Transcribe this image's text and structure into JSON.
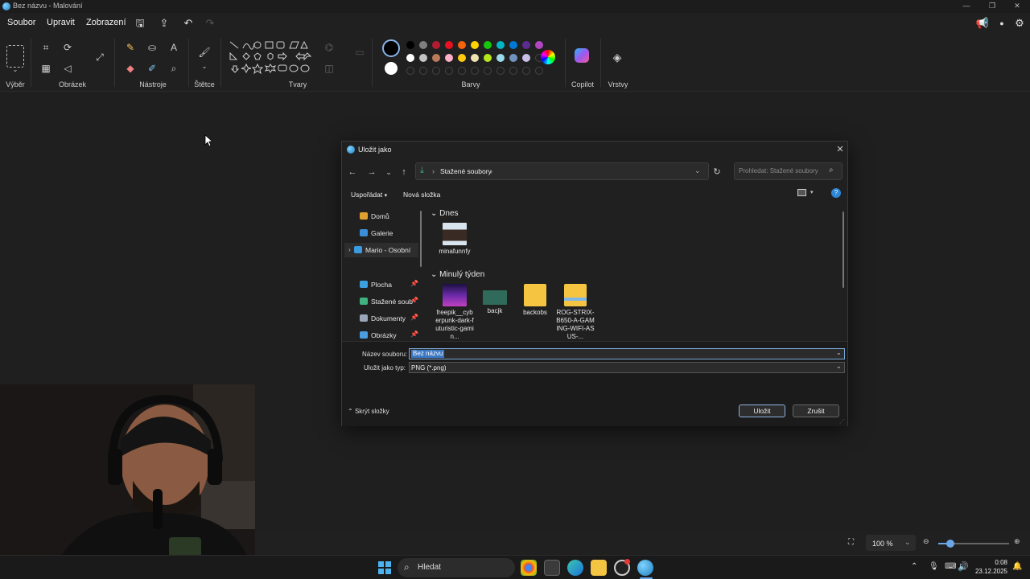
{
  "window": {
    "title": "Bez názvu - Malování"
  },
  "menu": {
    "items": [
      "Soubor",
      "Upravit",
      "Zobrazení"
    ]
  },
  "ribbon": {
    "groups": [
      "Výběr",
      "Obrázek",
      "Nástroje",
      "Štětce",
      "Tvary",
      "Barvy",
      "Copilot",
      "Vrstvy"
    ],
    "colors": [
      "#000000",
      "#7f7f7f",
      "#b21b32",
      "#e81123",
      "#f7630c",
      "#ffd400",
      "#16c60c",
      "#00b7c3",
      "#0078d4",
      "#5c2d91",
      "#b146c2",
      "#ffffff",
      "#c3c3c3",
      "#b97a57",
      "#ffaec9",
      "#ffc90e",
      "#efe4b0",
      "#b5e61d",
      "#99d9ea",
      "#7092be",
      "#c8bfe7"
    ]
  },
  "dialog": {
    "title": "Uložit jako",
    "breadcrumb": "Stažené soubory",
    "search_placeholder": "Prohledat: Stažené soubory",
    "organize": "Uspořádat",
    "new_folder": "Nová složka",
    "nav": [
      {
        "label": "Domů",
        "color": "#e0a030",
        "pinned": false
      },
      {
        "label": "Galerie",
        "color": "#3a8fd8",
        "pinned": false
      },
      {
        "label": "Mario - Osobní",
        "color": "#3a9be0",
        "pinned": false
      },
      {
        "label": "Plocha",
        "color": "#3aa0e0",
        "pinned": true
      },
      {
        "label": "Stažené soub",
        "color": "#3fb27f",
        "pinned": true
      },
      {
        "label": "Dokumenty",
        "color": "#9aa6b8",
        "pinned": true
      },
      {
        "label": "Obrázky",
        "color": "#4a9ee0",
        "pinned": true
      }
    ],
    "sections": [
      {
        "name": "Dnes",
        "files": [
          {
            "name": "minafunnfy"
          }
        ]
      },
      {
        "name": "Minulý týden",
        "files": [
          {
            "name": "freepik__cyberpunk-dark-futuristic-gamin..."
          },
          {
            "name": "bacjk"
          },
          {
            "name": "backobs"
          },
          {
            "name": "ROG-STRIX-B650-A-GAMING-WIFI-ASUS-..."
          }
        ]
      }
    ],
    "filename_label": "Název souboru:",
    "filename_value": "Bez názvu",
    "filetype_label": "Uložit jako typ:",
    "filetype_value": "PNG (*.png)",
    "hide_folders": "Skrýt složky",
    "save": "Uložit",
    "cancel": "Zrušit"
  },
  "status": {
    "zoom": "100 %"
  },
  "taskbar": {
    "search": "Hledat",
    "time": "0:08",
    "date": "23.12.2025"
  }
}
